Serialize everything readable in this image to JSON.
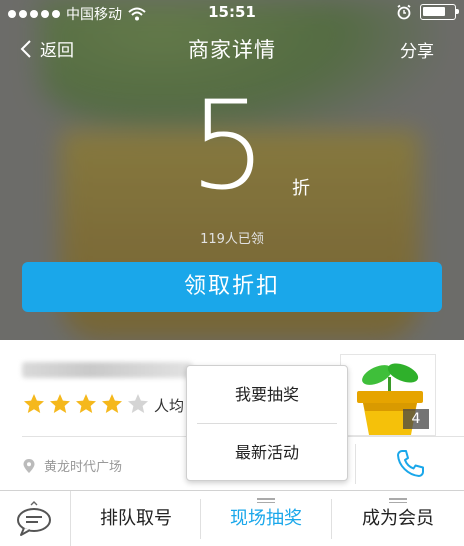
{
  "status_bar": {
    "carrier": "中国移动",
    "time": "15:51"
  },
  "nav": {
    "back_label": "返回",
    "title": "商家详情",
    "share_label": "分享"
  },
  "offer": {
    "discount_value": "5",
    "discount_unit": "折",
    "claimed_text": "119人已领",
    "claim_button_label": "领取折扣"
  },
  "merchant": {
    "rating_stars": 4,
    "rating_max": 5,
    "avg_label": "人均",
    "photo_count": "4",
    "location": "黄龙时代广场"
  },
  "popup_menu": {
    "items": [
      "我要抽奖",
      "最新活动"
    ]
  },
  "tab_bar": {
    "tabs": [
      "排队取号",
      "现场抽奖",
      "成为会员"
    ],
    "active_tab": "现场抽奖"
  },
  "colors": {
    "accent": "#1aa7ea",
    "star": "#f5b81c",
    "star_empty": "#d4d4d4"
  }
}
